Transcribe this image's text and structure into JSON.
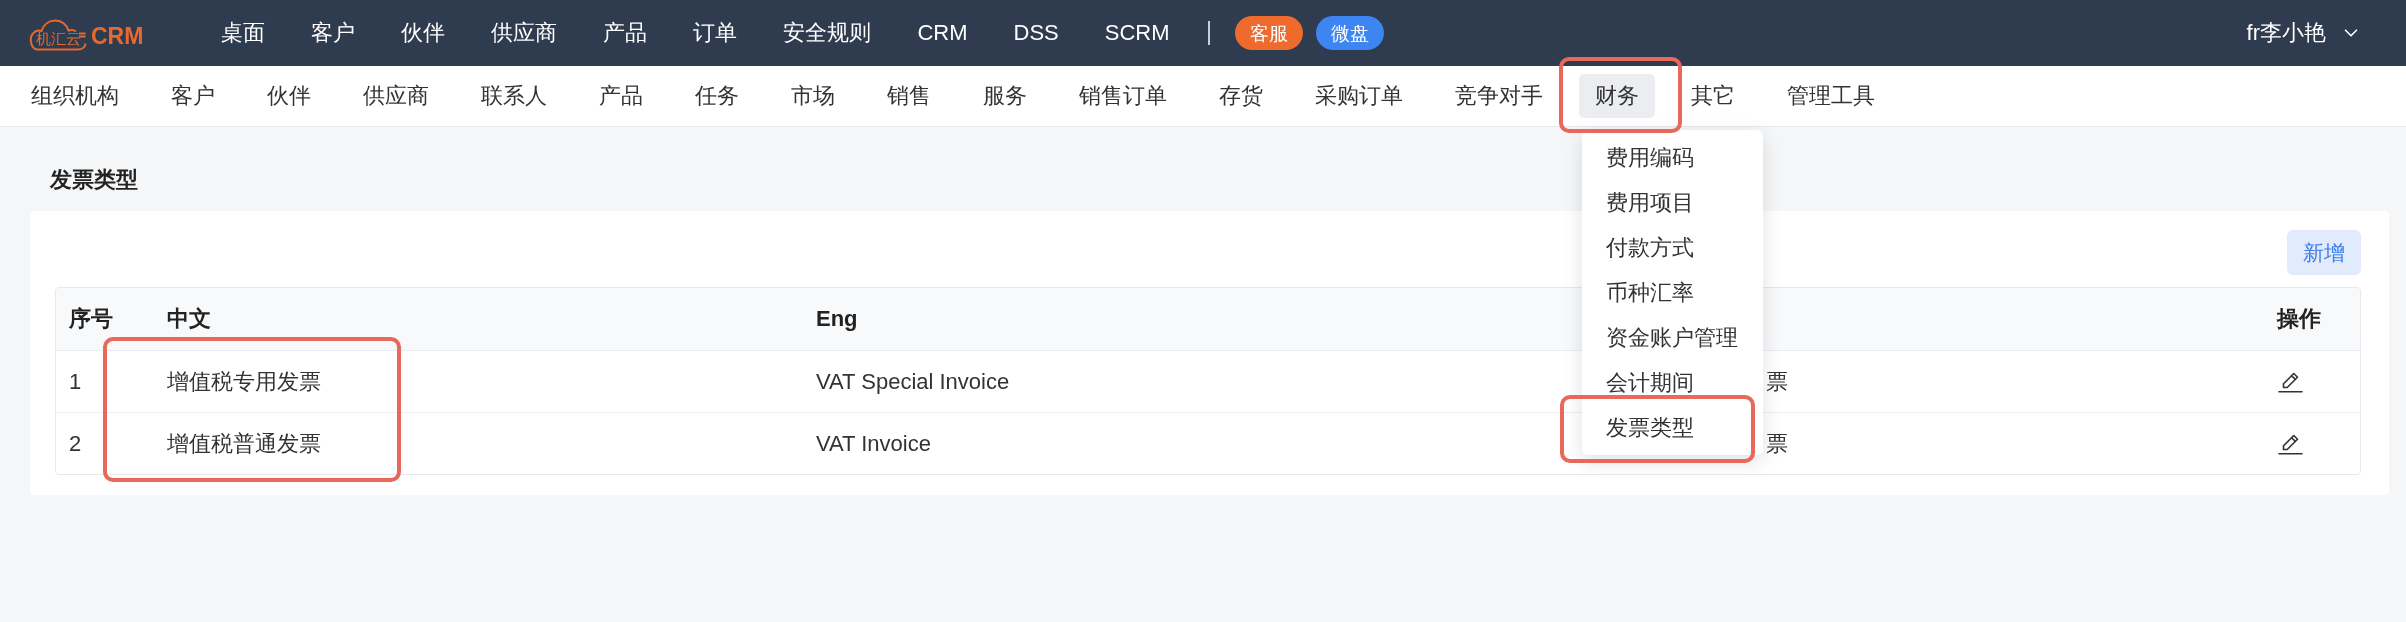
{
  "header": {
    "logo": {
      "cloud_text": "机汇云",
      "title": "CRM"
    },
    "nav": [
      "桌面",
      "客户",
      "伙伴",
      "供应商",
      "产品",
      "订单",
      "安全规则",
      "CRM",
      "DSS",
      "SCRM"
    ],
    "badges": [
      {
        "label": "客服",
        "color": "#ee6b2d"
      },
      {
        "label": "微盘",
        "color": "#3d85f0"
      }
    ],
    "user": "fr李小艳"
  },
  "sub_nav": [
    {
      "label": "组织机构",
      "selected": false,
      "highlighted": false
    },
    {
      "label": "客户",
      "selected": false,
      "highlighted": false
    },
    {
      "label": "伙伴",
      "selected": false,
      "highlighted": false
    },
    {
      "label": "供应商",
      "selected": false,
      "highlighted": false
    },
    {
      "label": "联系人",
      "selected": false,
      "highlighted": false
    },
    {
      "label": "产品",
      "selected": false,
      "highlighted": false
    },
    {
      "label": "任务",
      "selected": false,
      "highlighted": false
    },
    {
      "label": "市场",
      "selected": false,
      "highlighted": false
    },
    {
      "label": "销售",
      "selected": false,
      "highlighted": false
    },
    {
      "label": "服务",
      "selected": false,
      "highlighted": false
    },
    {
      "label": "销售订单",
      "selected": false,
      "highlighted": false
    },
    {
      "label": "存货",
      "selected": false,
      "highlighted": false
    },
    {
      "label": "采购订单",
      "selected": false,
      "highlighted": false
    },
    {
      "label": "竞争对手",
      "selected": false,
      "highlighted": false
    },
    {
      "label": "财务",
      "selected": true,
      "highlighted": true
    },
    {
      "label": "其它",
      "selected": false,
      "highlighted": false
    },
    {
      "label": "管理工具",
      "selected": false,
      "highlighted": false
    }
  ],
  "dropdown_menu": [
    {
      "label": "费用编码",
      "highlighted": false
    },
    {
      "label": "费用项目",
      "highlighted": false
    },
    {
      "label": "付款方式",
      "highlighted": false
    },
    {
      "label": "币种汇率",
      "highlighted": false
    },
    {
      "label": "资金账户管理",
      "highlighted": false
    },
    {
      "label": "会计期间",
      "highlighted": false
    },
    {
      "label": "发票类型",
      "highlighted": true
    }
  ],
  "page_title": "发票类型",
  "add_button": "新增",
  "table": {
    "columns": [
      {
        "label": "序号",
        "highlighted": false
      },
      {
        "label": "中文",
        "highlighted": true
      },
      {
        "label": "Eng",
        "highlighted": false
      },
      {
        "highlighted": false
      },
      {
        "label": "操作",
        "highlighted": false
      }
    ],
    "rows": [
      {
        "cells": [
          "1",
          "增值税专用发票",
          "VAT Special Invoice",
          "票"
        ]
      },
      {
        "cells": [
          "2",
          "增值税普通发票",
          "VAT Invoice",
          "票"
        ]
      }
    ]
  }
}
